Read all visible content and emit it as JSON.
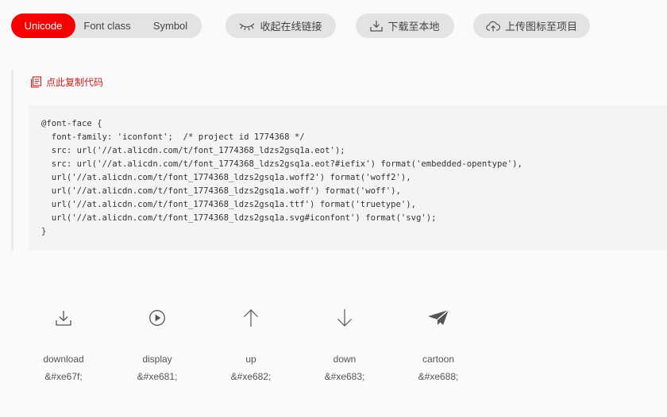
{
  "tabs": [
    {
      "label": "Unicode",
      "active": true
    },
    {
      "label": "Font class",
      "active": false
    },
    {
      "label": "Symbol",
      "active": false
    }
  ],
  "toolbar": {
    "collapse_label": "收起在线链接",
    "download_label": "下载至本地",
    "upload_label": "上传图标至项目"
  },
  "copy_label": "点此复制代码",
  "code_lines": [
    "@font-face {",
    "  font-family: 'iconfont';  /* project id 1774368 */",
    "  src: url('//at.alicdn.com/t/font_1774368_ldzs2gsq1a.eot');",
    "  src: url('//at.alicdn.com/t/font_1774368_ldzs2gsq1a.eot?#iefix') format('embedded-opentype'),",
    "  url('//at.alicdn.com/t/font_1774368_ldzs2gsq1a.woff2') format('woff2'),",
    "  url('//at.alicdn.com/t/font_1774368_ldzs2gsq1a.woff') format('woff'),",
    "  url('//at.alicdn.com/t/font_1774368_ldzs2gsq1a.ttf') format('truetype'),",
    "  url('//at.alicdn.com/t/font_1774368_ldzs2gsq1a.svg#iconfont') format('svg');",
    "}"
  ],
  "icons": [
    {
      "name": "download",
      "code": "&#xe67f;",
      "icon": "download-icon"
    },
    {
      "name": "display",
      "code": "&#xe681;",
      "icon": "play-icon"
    },
    {
      "name": "up",
      "code": "&#xe682;",
      "icon": "arrow-up-icon"
    },
    {
      "name": "down",
      "code": "&#xe683;",
      "icon": "arrow-down-icon"
    },
    {
      "name": "cartoon",
      "code": "&#xe688;",
      "icon": "paper-plane-icon"
    }
  ],
  "colors": {
    "accent": "#f90000",
    "copy_link": "#c41d1d",
    "button_bg": "#e3e3e3",
    "code_bg": "#f4f4f4",
    "page_bg": "#fafafa"
  }
}
